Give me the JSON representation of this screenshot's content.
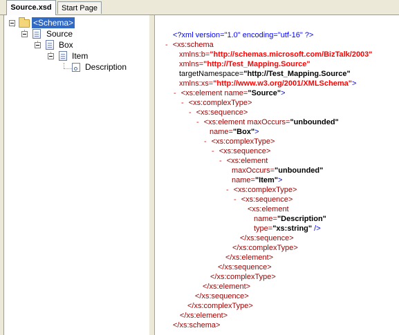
{
  "tabs": [
    {
      "label": "Source.xsd"
    },
    {
      "label": "Start Page"
    }
  ],
  "tree": {
    "root": "<Schema>",
    "source": "Source",
    "box": "Box",
    "item": "Item",
    "description": "Description"
  },
  "xml": {
    "pi": "<?xml version=\"1.0\" encoding=\"utf-16\" ?>",
    "minus": "-",
    "schema_open": "<xs:schema",
    "xmlns_b_name": "xmlns:b=",
    "xmlns_b_val": "\"http://schemas.microsoft.com/BizTalk/2003\"",
    "xmlns_name": "xmlns=",
    "xmlns_val": "\"http://Test_Mapping.Source\"",
    "tns_name": "targetNamespace=",
    "tns_val": "\"http://Test_Mapping.Source\"",
    "xmlns_xs_name": "xmlns:xs=",
    "xmlns_xs_val": "\"http://www.w3.org/2001/XMLSchema\"",
    "gt": ">",
    "el_source_open": "<xs:element name=",
    "el_source_val": "\"Source\"",
    "complex_open": "<xs:complexType>",
    "seq_open": "<xs:sequence>",
    "el_box_open": "<xs:element maxOccurs=",
    "unbounded": "\"unbounded\"",
    "name_attr": "name=",
    "box_val": "\"Box\"",
    "el_item_open": "<xs:element",
    "maxoccurs_attr": "maxOccurs=",
    "item_val": "\"Item\"",
    "el_desc_open": "<xs:element",
    "desc_val": "\"Description\"",
    "type_attr": "type=",
    "type_val": "\"xs:string\"",
    "selfclose": "/>",
    "seq_close": "</xs:sequence>",
    "complex_close": "</xs:complexType>",
    "el_close": "</xs:element>",
    "schema_close": "</xs:schema>"
  }
}
